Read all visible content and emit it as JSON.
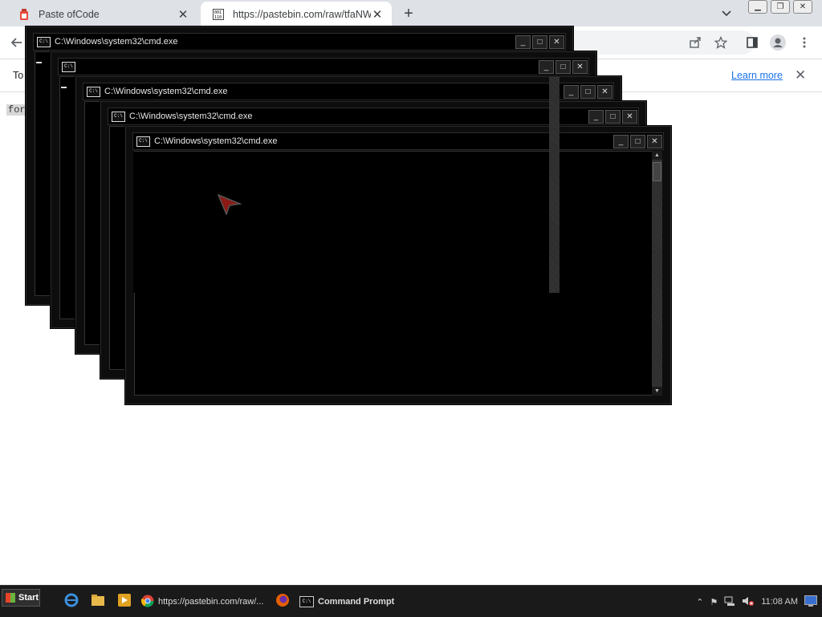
{
  "browser": {
    "tabs": [
      {
        "title": "Paste ofCode",
        "close": "✕"
      },
      {
        "title": "https://pastebin.com/raw/tfaNW",
        "close": "✕"
      }
    ],
    "new_tab": "+",
    "infobar": {
      "message": "To",
      "learn_more": "Learn more",
      "close": "✕"
    },
    "page_text": "for"
  },
  "cmd_windows": [
    {
      "title": "C:\\Windows\\system32\\cmd.exe"
    },
    {
      "title": ""
    },
    {
      "title": "C:\\Windows\\system32\\cmd.exe"
    },
    {
      "title": "C:\\Windows\\system32\\cmd.exe"
    },
    {
      "title": "C:\\Windows\\system32\\cmd.exe"
    }
  ],
  "cmd_icon_text": "C:\\",
  "taskbar": {
    "start": "Start",
    "tasks": [
      {
        "label": "https://pastebin.com/raw/..."
      },
      {
        "label": "Command Prompt"
      }
    ],
    "clock": "11:08 AM"
  },
  "colors": {
    "cmd_bg": "#000000",
    "tabstrip": "#dee1e6",
    "link": "#1a73e8",
    "taskbar": "#1a1a1a"
  }
}
